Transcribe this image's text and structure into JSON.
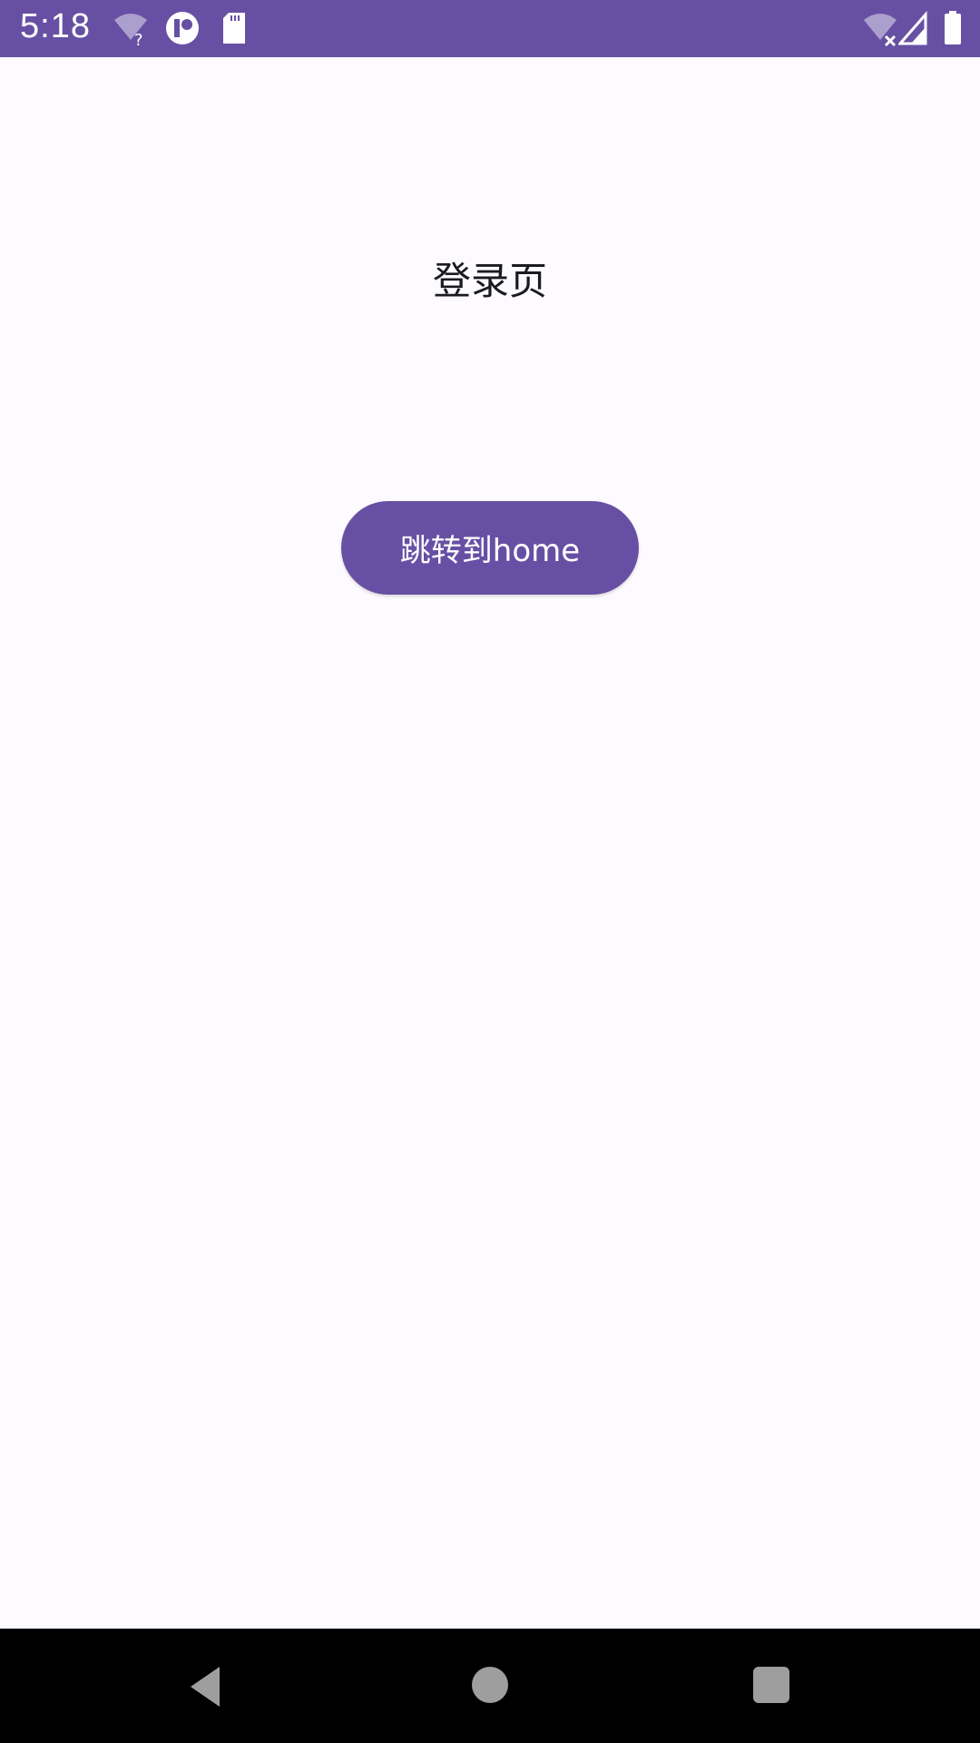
{
  "status_bar": {
    "time": "5:18",
    "background_color": "#6750a4",
    "icons_left": [
      "wifi-question-icon",
      "circle-app-icon",
      "sd-card-icon"
    ],
    "icons_right": [
      "wifi-x-icon",
      "signal-icon",
      "battery-icon"
    ]
  },
  "main": {
    "title": "登录页",
    "button_label": "跳转到home",
    "accent_color": "#6750a4"
  },
  "nav_bar": {
    "buttons": [
      "back-icon",
      "home-icon",
      "recents-icon"
    ]
  }
}
